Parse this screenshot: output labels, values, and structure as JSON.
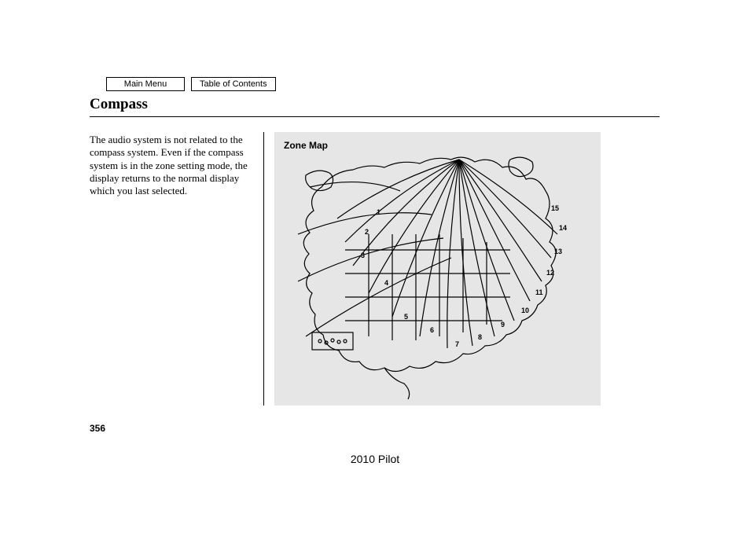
{
  "nav": {
    "main_menu": "Main Menu",
    "toc": "Table of Contents"
  },
  "section": {
    "title": "Compass"
  },
  "body": {
    "paragraph": "The audio system is not related to the compass system. Even if the compass system is in the zone setting mode, the display returns to the normal display which you last selected."
  },
  "figure": {
    "label": "Zone Map",
    "zones": [
      "1",
      "2",
      "3",
      "4",
      "5",
      "6",
      "7",
      "8",
      "9",
      "10",
      "11",
      "12",
      "13",
      "14",
      "15"
    ]
  },
  "page_number": "356",
  "footer": {
    "model": "2010 Pilot"
  }
}
